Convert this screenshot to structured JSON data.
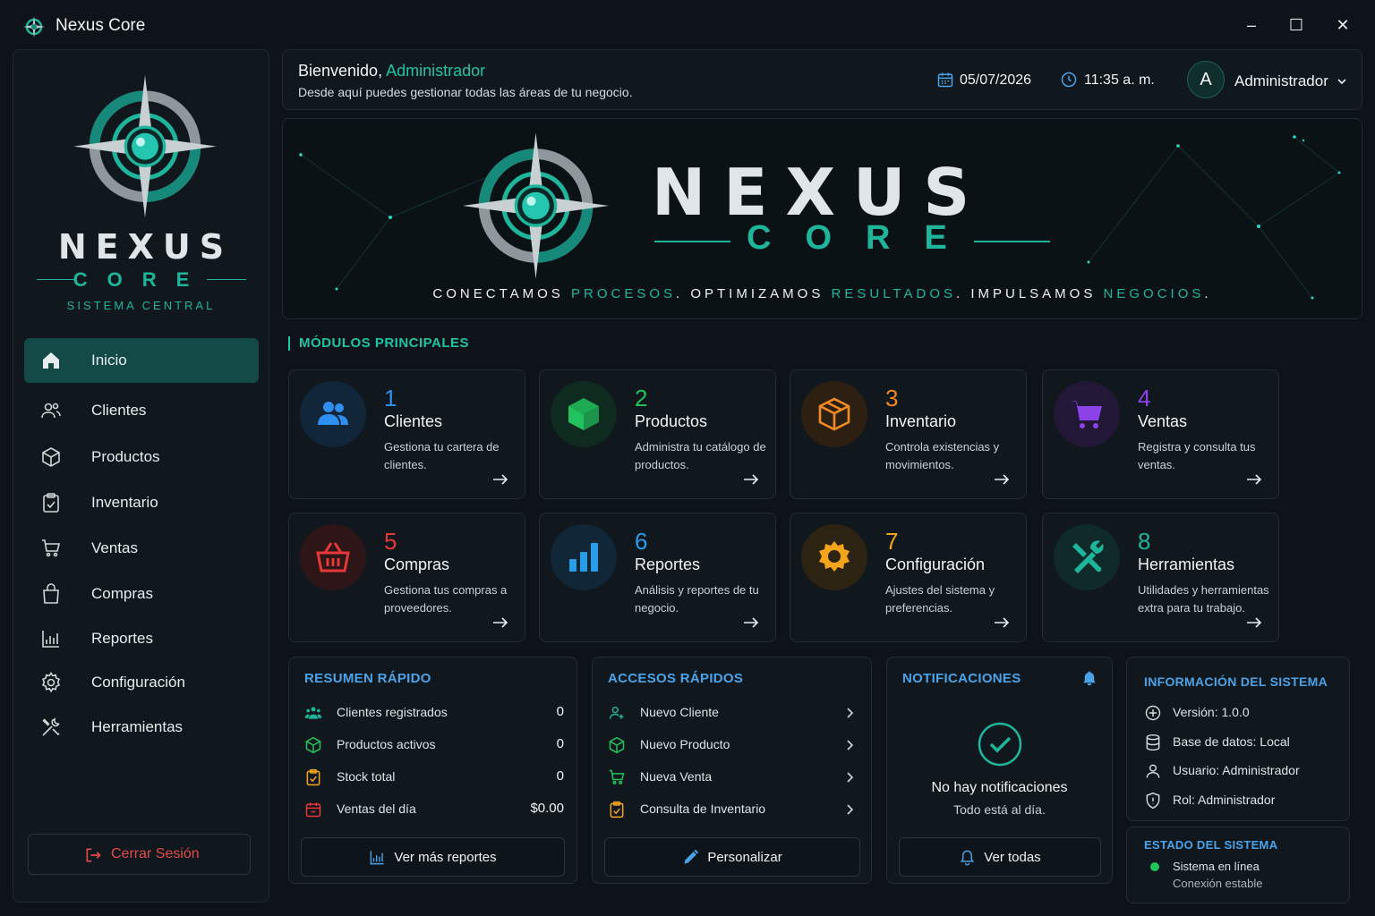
{
  "window": {
    "title": "Nexus Core",
    "minimize": "–",
    "maximize": "☐",
    "close": "✕"
  },
  "sidebar": {
    "brand": "NEXUS",
    "brand_sub": "CORE",
    "tagline": "SISTEMA CENTRAL",
    "items": [
      {
        "label": "Inicio",
        "icon": "home-icon",
        "active": true
      },
      {
        "label": "Clientes",
        "icon": "users-icon"
      },
      {
        "label": "Productos",
        "icon": "box-icon"
      },
      {
        "label": "Inventario",
        "icon": "clipboard-icon"
      },
      {
        "label": "Ventas",
        "icon": "cart-icon"
      },
      {
        "label": "Compras",
        "icon": "bag-icon"
      },
      {
        "label": "Reportes",
        "icon": "bar-chart-icon"
      },
      {
        "label": "Configuración",
        "icon": "gear-icon"
      },
      {
        "label": "Herramientas",
        "icon": "tools-icon"
      }
    ],
    "logout": "Cerrar Sesión"
  },
  "header": {
    "welcome": "Bienvenido,",
    "user_highlight": "Administrador",
    "subtitle": "Desde aquí puedes gestionar todas las áreas de tu negocio.",
    "date": "05/07/2026",
    "time": "11:35 a. m.",
    "avatar_letter": "A",
    "user": "Administrador"
  },
  "banner": {
    "brand": "NEXUS",
    "brand_sub": "CORE",
    "tag_1": "CONECTAMOS ",
    "tag_2": "PROCESOS",
    "tag_3": ". OPTIMIZAMOS ",
    "tag_4": "RESULTADOS",
    "tag_5": ". IMPULSAMOS ",
    "tag_6": "NEGOCIOS",
    "tag_7": "."
  },
  "modules": {
    "title": "MÓDULOS PRINCIPALES",
    "cards": [
      {
        "num": "1",
        "title": "Clientes",
        "desc": "Gestiona tu cartera de clientes.",
        "color": "#2f8ff0",
        "bg": "#12263a",
        "icon": "users-icon"
      },
      {
        "num": "2",
        "title": "Productos",
        "desc": "Administra tu catálogo de productos.",
        "color": "#22c25e",
        "bg": "#0f2a1e",
        "icon": "cube-icon"
      },
      {
        "num": "3",
        "title": "Inventario",
        "desc": "Controla existencias y movimientos.",
        "color": "#f08a24",
        "bg": "#2d2013",
        "icon": "package-icon"
      },
      {
        "num": "4",
        "title": "Ventas",
        "desc": "Registra y consulta tus ventas.",
        "color": "#8b43e8",
        "bg": "#221737",
        "icon": "cart-icon"
      },
      {
        "num": "5",
        "title": "Compras",
        "desc": "Gestiona tus compras a proveedores.",
        "color": "#e53838",
        "bg": "#2d1518",
        "icon": "basket-icon"
      },
      {
        "num": "6",
        "title": "Reportes",
        "desc": "Análisis y reportes de tu negocio.",
        "color": "#2a9de8",
        "bg": "#112636",
        "icon": "bar-chart-icon"
      },
      {
        "num": "7",
        "title": "Configuración",
        "desc": "Ajustes del sistema y preferencias.",
        "color": "#f4a51c",
        "bg": "#2d2312",
        "icon": "gear-icon"
      },
      {
        "num": "8",
        "title": "Herramientas",
        "desc": "Utilidades y herramientas extra para tu trabajo.",
        "color": "#1fb59b",
        "bg": "#0f2a28",
        "icon": "tools-icon"
      }
    ]
  },
  "summary": {
    "title": "RESUMEN RÁPIDO",
    "rows": [
      {
        "label": "Clientes registrados",
        "value": "0",
        "icon": "users-icon",
        "color": "#1fb59b"
      },
      {
        "label": "Productos activos",
        "value": "0",
        "icon": "cube-icon",
        "color": "#22c25e"
      },
      {
        "label": "Stock total",
        "value": "0",
        "icon": "clipboard-icon",
        "color": "#f4a51c"
      },
      {
        "label": "Ventas del día",
        "value": "$0.00",
        "icon": "calendar-icon",
        "color": "#e53838"
      }
    ],
    "button": "Ver más reportes"
  },
  "quick": {
    "title": "ACCESOS RÁPIDOS",
    "rows": [
      {
        "label": "Nuevo Cliente",
        "icon": "user-add-icon",
        "color": "#1fb59b"
      },
      {
        "label": "Nuevo Producto",
        "icon": "cube-icon",
        "color": "#22c25e"
      },
      {
        "label": "Nueva Venta",
        "icon": "cart-icon",
        "color": "#22c25e"
      },
      {
        "label": "Consulta de Inventario",
        "icon": "clipboard-icon",
        "color": "#f4a51c"
      }
    ],
    "button": "Personalizar"
  },
  "notifications": {
    "title": "NOTIFICACIONES",
    "empty_title": "No hay notificaciones",
    "empty_sub": "Todo está al día.",
    "button": "Ver todas"
  },
  "sysinfo": {
    "title": "INFORMACIÓN DEL SISTEMA",
    "rows": [
      {
        "label": "Versión: 1.0.0",
        "icon": "plus-circle-icon"
      },
      {
        "label": "Base de datos: Local",
        "icon": "database-icon"
      },
      {
        "label": "Usuario: Administrador",
        "icon": "user-icon"
      },
      {
        "label": "Rol: Administrador",
        "icon": "shield-icon"
      }
    ]
  },
  "status": {
    "title": "ESTADO DEL SISTEMA",
    "line1": "Sistema en línea",
    "line2": "Conexión estable",
    "dot_color": "#22c25e"
  },
  "colors": {
    "accent": "#1fb59b",
    "panel_title": "#4aa3e8",
    "danger": "#e24a4a"
  }
}
